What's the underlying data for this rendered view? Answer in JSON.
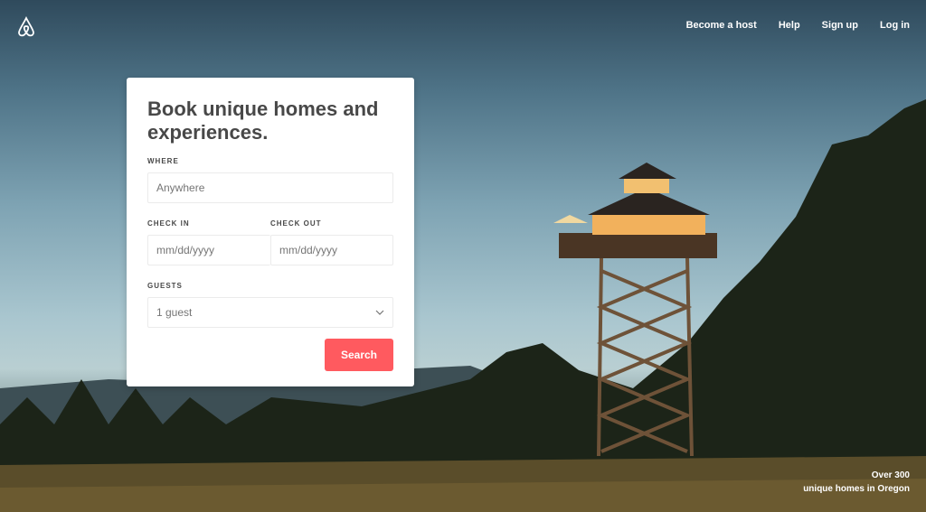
{
  "nav": {
    "logo": "airbnb-logo",
    "items": [
      "Become a host",
      "Help",
      "Sign up",
      "Log in"
    ]
  },
  "card": {
    "title": "Book unique homes and experiences.",
    "where_label": "WHERE",
    "where_placeholder": "Anywhere",
    "checkin_label": "CHECK IN",
    "checkin_placeholder": "mm/dd/yyyy",
    "checkout_label": "CHECK OUT",
    "checkout_placeholder": "mm/dd/yyyy",
    "guests_label": "GUESTS",
    "guests_value": "1 guest",
    "search_label": "Search"
  },
  "caption": {
    "line1": "Over 300",
    "line2": "unique homes in Oregon"
  },
  "colors": {
    "accent": "#ff5a5f"
  }
}
